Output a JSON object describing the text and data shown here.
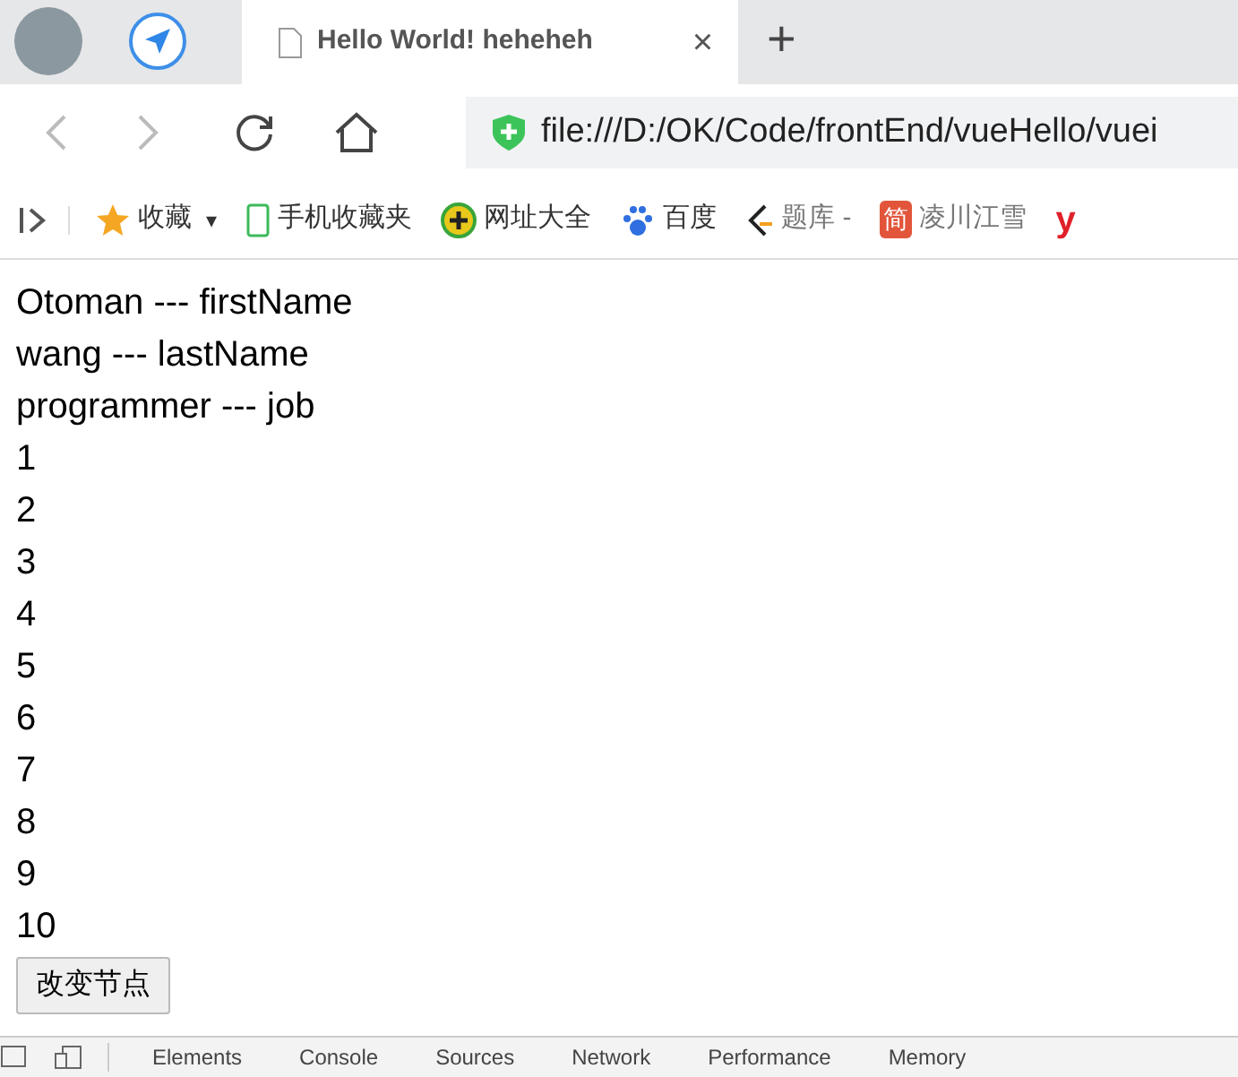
{
  "browser": {
    "tabs": [
      {
        "title": "Hello World! heheheh",
        "selected": true,
        "close": "×"
      }
    ],
    "new_tab": "+",
    "address": "file:///D:/OK/Code/frontEnd/vueHello/vuei",
    "bookmarks": [
      {
        "kind": "star",
        "label": "收藏",
        "caret": "▾"
      },
      {
        "kind": "phone",
        "label": "手机收藏夹"
      },
      {
        "kind": "plus",
        "label": "网址大全"
      },
      {
        "kind": "paw",
        "label": "百度"
      },
      {
        "kind": "leet",
        "label": "题库 -"
      },
      {
        "kind": "jian",
        "label": "凌川江雪",
        "icon_text": "简"
      },
      {
        "kind": "letter",
        "label": "y"
      }
    ]
  },
  "page": {
    "lines": [
      "Otoman --- firstName",
      "wang --- lastName",
      "programmer --- job",
      "1",
      "2",
      "3",
      "4",
      "5",
      "6",
      "7",
      "8",
      "9",
      "10"
    ],
    "button": "改变节点"
  },
  "devtools": {
    "tabs": [
      {
        "label": "Elements",
        "selected": false
      },
      {
        "label": "Console",
        "selected": false
      },
      {
        "label": "Sources",
        "selected": false
      },
      {
        "label": "Network",
        "selected": false
      },
      {
        "label": "Performance",
        "selected": false
      },
      {
        "label": "Memory",
        "selected": false
      }
    ]
  }
}
